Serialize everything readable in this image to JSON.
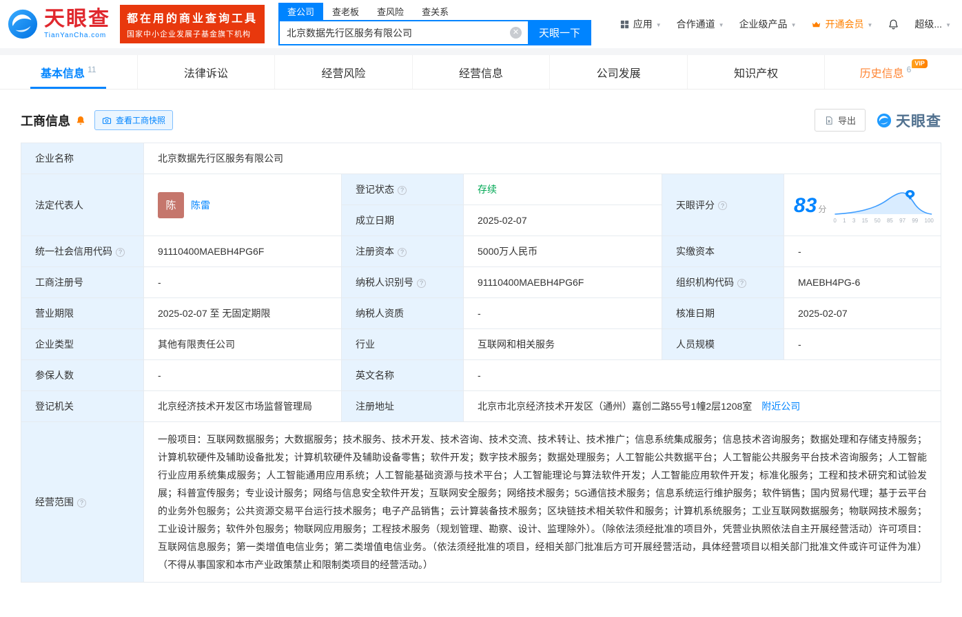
{
  "brand": {
    "logo_cn": "天眼查",
    "logo_en": "TianYanCha.com",
    "slogan_line1": "都在用的商业查询工具",
    "slogan_line2": "国家中小企业发展子基金旗下机构"
  },
  "search": {
    "tabs": [
      "查公司",
      "查老板",
      "查风险",
      "查关系"
    ],
    "value": "北京数据先行区服务有限公司",
    "button_label": "天眼一下"
  },
  "nav": {
    "apps": "应用",
    "partners": "合作通道",
    "enterprise": "企业级产品",
    "vip": "开通会员",
    "user": "超级..."
  },
  "tabs": {
    "basic": {
      "label": "基本信息",
      "count": "11"
    },
    "legal": {
      "label": "法律诉讼"
    },
    "risk": {
      "label": "经营风险"
    },
    "operation": {
      "label": "经营信息"
    },
    "development": {
      "label": "公司发展"
    },
    "ip": {
      "label": "知识产权"
    },
    "history": {
      "label": "历史信息",
      "count": "6",
      "badge": "VIP"
    }
  },
  "section": {
    "title": "工商信息",
    "snapshot_button": "查看工商快照",
    "export_button": "导出",
    "watermark": "天眼查"
  },
  "info": {
    "company_name": {
      "label": "企业名称",
      "value": "北京数据先行区服务有限公司"
    },
    "legal_rep": {
      "label": "法定代表人",
      "avatar": "陈",
      "name": "陈雷"
    },
    "reg_status": {
      "label": "登记状态",
      "value": "存续"
    },
    "establish_date": {
      "label": "成立日期",
      "value": "2025-02-07"
    },
    "score": {
      "label": "天眼评分",
      "value": "83",
      "unit": "分",
      "axis": [
        "0",
        "1",
        "3",
        "15",
        "50",
        "85",
        "97",
        "99",
        "100"
      ]
    },
    "credit_code": {
      "label": "统一社会信用代码",
      "value": "91110400MAEBH4PG6F"
    },
    "reg_capital": {
      "label": "注册资本",
      "value": "5000万人民币"
    },
    "paid_capital": {
      "label": "实缴资本",
      "value": "-"
    },
    "reg_number": {
      "label": "工商注册号",
      "value": "-"
    },
    "taxpayer_id": {
      "label": "纳税人识别号",
      "value": "91110400MAEBH4PG6F"
    },
    "org_code": {
      "label": "组织机构代码",
      "value": "MAEBH4PG-6"
    },
    "business_term": {
      "label": "营业期限",
      "value": "2025-02-07 至 无固定期限"
    },
    "taxpayer_quality": {
      "label": "纳税人资质",
      "value": "-"
    },
    "approval_date": {
      "label": "核准日期",
      "value": "2025-02-07"
    },
    "company_type": {
      "label": "企业类型",
      "value": "其他有限责任公司"
    },
    "industry": {
      "label": "行业",
      "value": "互联网和相关服务"
    },
    "staff_size": {
      "label": "人员规模",
      "value": "-"
    },
    "insured_count": {
      "label": "参保人数",
      "value": "-"
    },
    "english_name": {
      "label": "英文名称",
      "value": "-"
    },
    "reg_authority": {
      "label": "登记机关",
      "value": "北京经济技术开发区市场监督管理局"
    },
    "reg_address": {
      "label": "注册地址",
      "value": "北京市北京经济技术开发区（通州）嘉创二路55号1幢2层1208室",
      "nearby_link": "附近公司"
    },
    "business_scope": {
      "label": "经营范围",
      "value": "一般项目：互联网数据服务；大数据服务；技术服务、技术开发、技术咨询、技术交流、技术转让、技术推广；信息系统集成服务；信息技术咨询服务；数据处理和存储支持服务；计算机软硬件及辅助设备批发；计算机软硬件及辅助设备零售；软件开发；数字技术服务；数据处理服务；人工智能公共数据平台；人工智能公共服务平台技术咨询服务；人工智能行业应用系统集成服务；人工智能通用应用系统；人工智能基础资源与技术平台；人工智能理论与算法软件开发；人工智能应用软件开发；标准化服务；工程和技术研究和试验发展；科普宣传服务；专业设计服务；网络与信息安全软件开发；互联网安全服务；网络技术服务；5G通信技术服务；信息系统运行维护服务；软件销售；国内贸易代理；基于云平台的业务外包服务；公共资源交易平台运行技术服务；电子产品销售；云计算装备技术服务；区块链技术相关软件和服务；计算机系统服务；工业互联网数据服务；物联网技术服务；工业设计服务；软件外包服务；物联网应用服务；工程技术服务（规划管理、勘察、设计、监理除外）。（除依法须经批准的项目外，凭营业执照依法自主开展经营活动）许可项目：互联网信息服务；第一类增值电信业务；第二类增值电信业务。（依法须经批准的项目，经相关部门批准后方可开展经营活动，具体经营项目以相关部门批准文件或许可证件为准）（不得从事国家和本市产业政策禁止和限制类项目的经营活动。）"
    }
  }
}
